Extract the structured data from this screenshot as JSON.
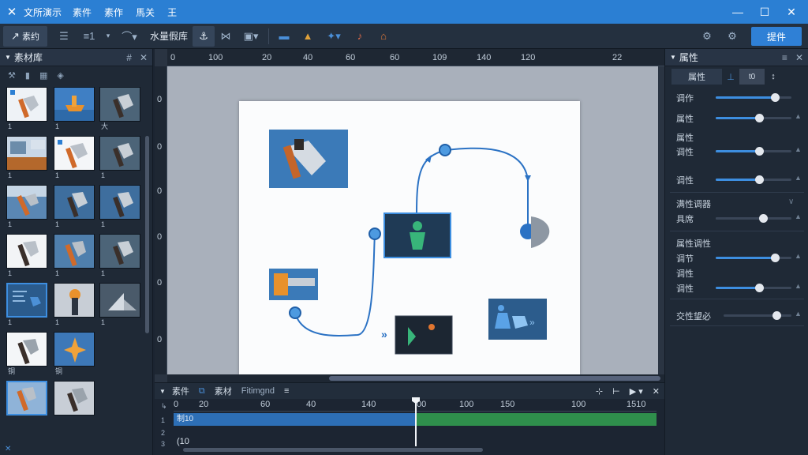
{
  "app": {
    "title": "文所演示",
    "menus": [
      "素件",
      "素作",
      "馬关",
      "王"
    ]
  },
  "colors": {
    "accent": "#2b7fd3",
    "panel": "#1f2936",
    "green_clip": "#2f8f4c",
    "blue_clip": "#2d6fb6"
  },
  "toolbar": {
    "select_label": "素约",
    "text_label": "水量假库",
    "export_label": "提件"
  },
  "left_panel": {
    "title": "素材库",
    "captions": [
      "1",
      "1",
      "大",
      "1",
      "1",
      "1",
      "1",
      "1",
      "1",
      "1",
      "1",
      "1",
      "1",
      "1",
      "1",
      "铜",
      "铜",
      "",
      "1",
      "1",
      "",
      "",
      ""
    ]
  },
  "ruler": {
    "top": [
      "0",
      "100",
      "20",
      "40",
      "60",
      "60",
      "109",
      "140",
      "120",
      "22"
    ],
    "left": [
      "0",
      "0",
      "0",
      "0",
      "0",
      "0",
      "0",
      "0"
    ]
  },
  "right_panel": {
    "title": "属性",
    "tab_label": "属性",
    "tab_value": "t0",
    "group1": [
      {
        "label": "调作",
        "value": 0.78
      },
      {
        "label": "属性",
        "value": 0.57
      },
      {
        "label": "属性",
        "value": null
      },
      {
        "label": "调性",
        "value": 0.57
      },
      {
        "label": "调性",
        "value": 0.57
      }
    ],
    "group2_header": "满性调器",
    "group2_row": {
      "label": "具席",
      "value": 0.62
    },
    "group3_header": "属性调性",
    "group3": [
      {
        "label": "调节",
        "value": 0.78
      },
      {
        "label": "调性",
        "value": null
      },
      {
        "label": "调性",
        "value": 0.57
      }
    ],
    "group4": {
      "label": "交性望必",
      "value": 0.78
    }
  },
  "timeline": {
    "tabs": [
      "素件",
      "素材",
      "Fitimgnd"
    ],
    "ticks": [
      "0",
      "20",
      "60",
      "40",
      "140",
      "00",
      "100",
      "150",
      "100",
      "1510"
    ],
    "clip_label": "制10",
    "track_numbers": [
      "1",
      "2",
      "3"
    ],
    "footer": "(10"
  }
}
